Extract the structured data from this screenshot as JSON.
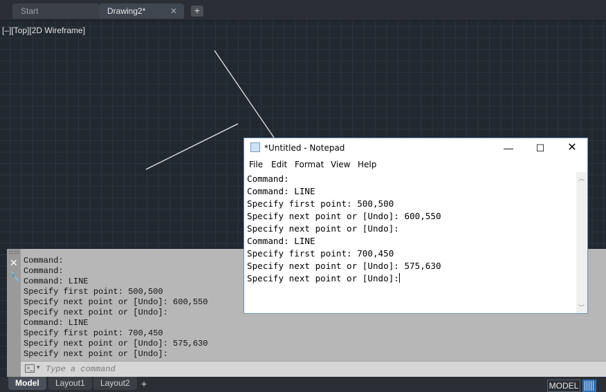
{
  "doc_tabs": {
    "start_label": "Start",
    "drawing_label": "Drawing2*",
    "close_glyph": "✕",
    "add_glyph": "+"
  },
  "viewport": {
    "label": "[–][Top][2D Wireframe]"
  },
  "drawing": {
    "line_color": "#e8e8e8",
    "background_color": "#212830"
  },
  "command_window": {
    "close_glyph": "✕",
    "wrench_icon": "wrench-icon",
    "history": "Command:\nCommand:\nCommand: LINE\nSpecify first point: 500,500\nSpecify next point or [Undo]: 600,550\nSpecify next point or [Undo]:\nCommand: LINE\nSpecify first point: 700,450\nSpecify next point or [Undo]: 575,630\nSpecify next point or [Undo]:",
    "input_placeholder": "Type a command",
    "input_value": ""
  },
  "notepad": {
    "title": "*Untitled - Notepad",
    "min_glyph": "—",
    "max_glyph": "☐",
    "close_glyph": "✕",
    "menu": [
      "File",
      "Edit",
      "Format",
      "View",
      "Help"
    ],
    "text": "Command:\nCommand: LINE\nSpecify first point: 500,500\nSpecify next point or [Undo]: 600,550\nSpecify next point or [Undo]:\nCommand: LINE\nSpecify first point: 700,450\nSpecify next point or [Undo]: 575,630\nSpecify next point or [Undo]:"
  },
  "layout_tabs": {
    "model": "Model",
    "layout1": "Layout1",
    "layout2": "Layout2",
    "add_glyph": "+"
  },
  "status": {
    "model_button": "MODEL",
    "grid_icon": "grid-icon"
  },
  "colors": {
    "accent": "#2f6fb3",
    "command_window_bg": "#b7b7b7"
  }
}
